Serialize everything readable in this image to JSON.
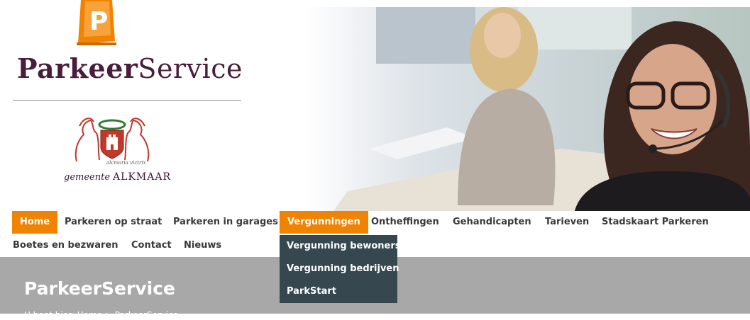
{
  "logo": {
    "brand_bold": "Parkeer",
    "brand_light": "Service",
    "motto": "alcmaria victrix",
    "gemeente_italic": "gemeente",
    "gemeente_name": "ALKMAAR"
  },
  "nav": {
    "row1": [
      "Home",
      "Parkeren op straat",
      "Parkeren in garages",
      "Vergunningen",
      "Ontheffingen",
      "Gehandicapten",
      "Tarieven",
      "Stadskaart Parkeren"
    ],
    "row2": [
      "Boetes en bezwaren",
      "Contact",
      "Nieuws"
    ]
  },
  "dropdown": [
    "Vergunning bewoners",
    "Vergunning bedrijven",
    "ParkStart"
  ],
  "banner": {
    "title": "ParkeerService",
    "breadcrumb": "U bent hier: Home > ParkeerService"
  },
  "colors": {
    "accent": "#f08300",
    "dropdown_bg": "#37474f",
    "banner_bg": "#a8a8a8",
    "brand": "#4a1d3a"
  }
}
